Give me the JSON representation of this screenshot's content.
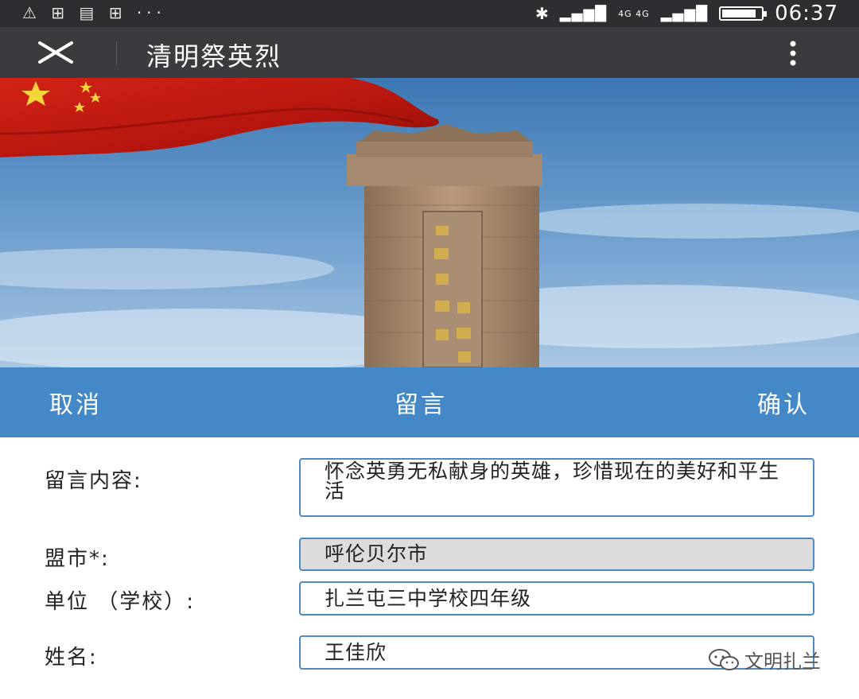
{
  "status_bar": {
    "left_icons": [
      "warning-icon",
      "data-icon",
      "message-icon",
      "data-icon",
      "more-icon"
    ],
    "sim1_label": "ıl",
    "sim2_label": "4G 4G",
    "battery_percent": 88,
    "time": "06:37"
  },
  "title_bar": {
    "title": "清明祭英烈"
  },
  "action_bar": {
    "cancel": "取消",
    "title": "留言",
    "confirm": "确认"
  },
  "form": {
    "message_label": "留言内容:",
    "message_value": "怀念英勇无私献身的英雄，珍惜现在的美好和平生活",
    "city_label": "盟市*:",
    "city_value": "呼伦贝尔市",
    "unit_label": "单位 （学校）:",
    "unit_value": "扎兰屯三中学校四年级",
    "name_label": "姓名:",
    "name_value": "王佳欣"
  },
  "watermark": {
    "text": "文明扎兰"
  },
  "colors": {
    "status_bar": "#2c2e31",
    "title_bar": "#3a3b3e",
    "action_bar": "#4588c8",
    "field_border": "#4f8ac4"
  }
}
